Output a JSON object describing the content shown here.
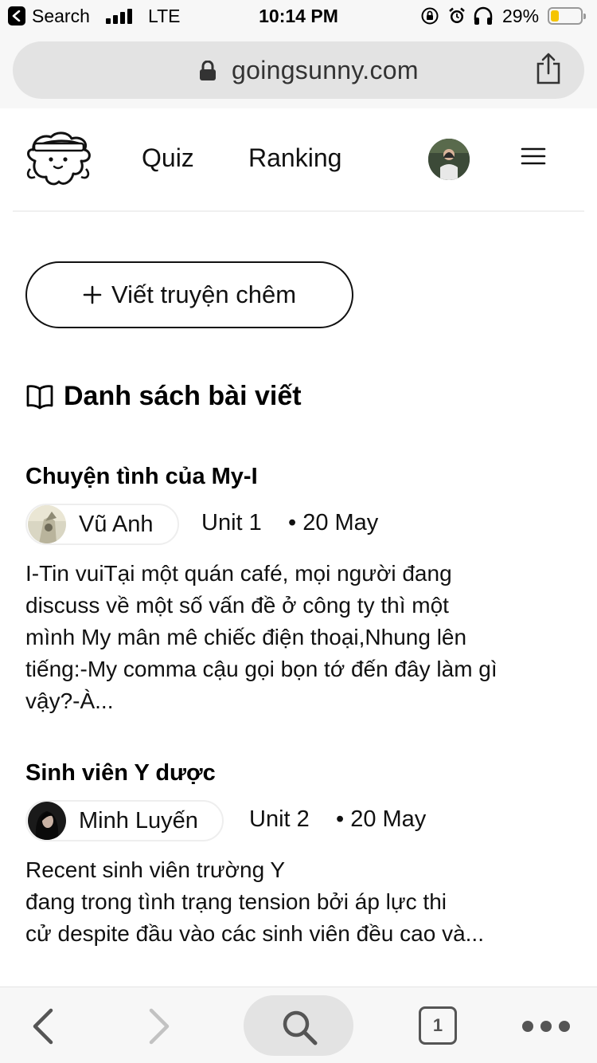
{
  "status_bar": {
    "back_app": "Search",
    "carrier": "LTE",
    "time": "10:14 PM",
    "battery": "29%",
    "battery_level": 0.29
  },
  "browser": {
    "url": "goingsunny.com",
    "tab_count": "1"
  },
  "header": {
    "nav": [
      {
        "label": "Quiz"
      },
      {
        "label": "Ranking"
      }
    ]
  },
  "write_button": {
    "label": "Viết truyện chêm"
  },
  "section": {
    "title": "Danh sách bài viết"
  },
  "posts": [
    {
      "title": "Chuyện tình của My-I",
      "author": "Vũ Anh",
      "unit": "Unit 1",
      "date": "• 20 May",
      "excerpt_lines": [
        "I-Tin vuiTại một quán café, mọi người đang",
        "discuss về một số vấn đề ở công ty thì một",
        "mình My mân mê chiếc điện thoại,Nhung lên",
        "tiếng:-My comma cậu gọi bọn tớ đến đây làm gì",
        "vậy?-À..."
      ]
    },
    {
      "title": "Sinh viên Y dược",
      "author": "Minh Luyến",
      "unit": "Unit 2",
      "date": "• 20 May",
      "excerpt_lines": [
        "Recent sinh viên trường Y",
        "đang trong tình trạng tension bởi áp lực thi",
        "cử despite đầu vào các sinh viên đều cao và..."
      ]
    }
  ],
  "colors": {
    "battery_fill": "#f5c400",
    "chrome_bg": "#f7f7f7",
    "pill_bg": "#e3e3e3"
  }
}
